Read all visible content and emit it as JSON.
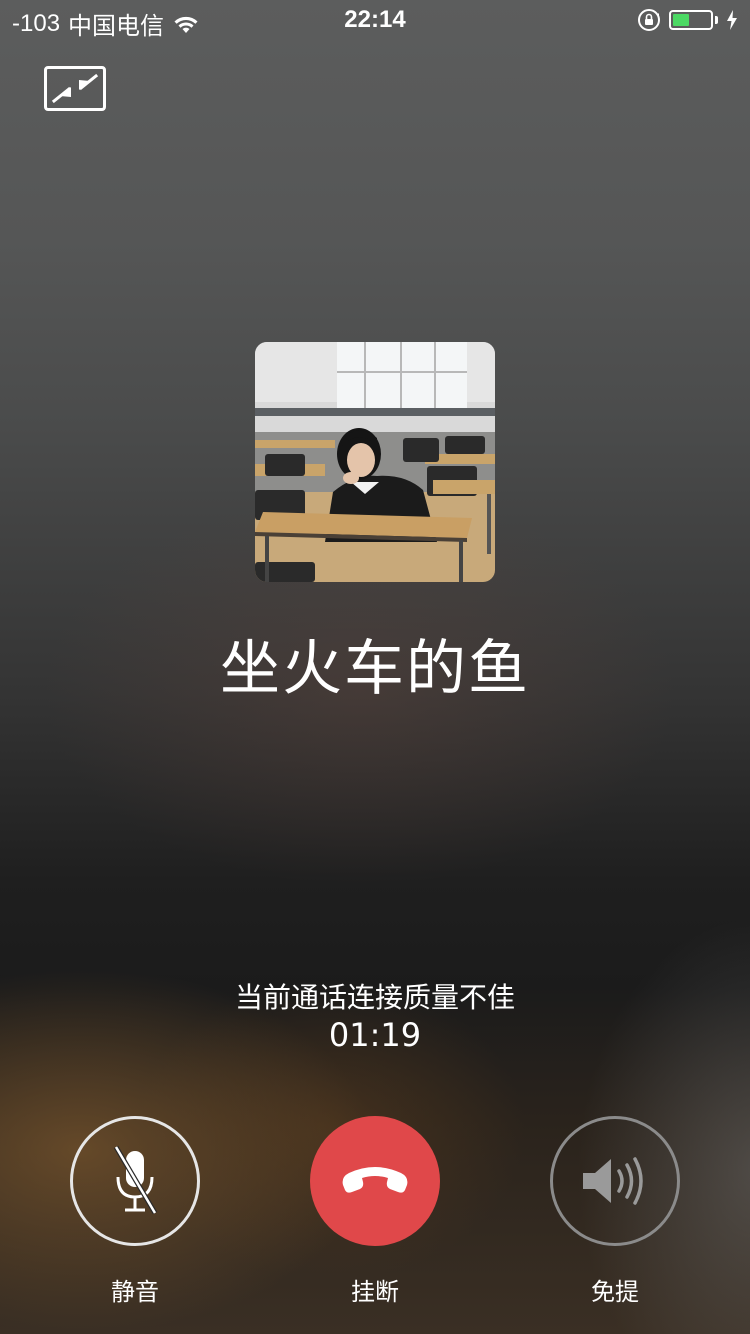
{
  "status_bar": {
    "signal": "-103",
    "carrier": "中国电信",
    "time": "22:14",
    "battery_level_percent": 45,
    "icons": [
      "wifi-icon",
      "orientation-lock-icon",
      "battery-icon",
      "charging-icon"
    ]
  },
  "call": {
    "contact_name": "坐火车的鱼",
    "status_text": "当前通话连接质量不佳",
    "duration": "01:19"
  },
  "controls": {
    "mute_label": "静音",
    "hangup_label": "挂断",
    "speaker_label": "免提"
  },
  "colors": {
    "hangup": "#e0484a",
    "battery_fill": "#4cd964"
  }
}
